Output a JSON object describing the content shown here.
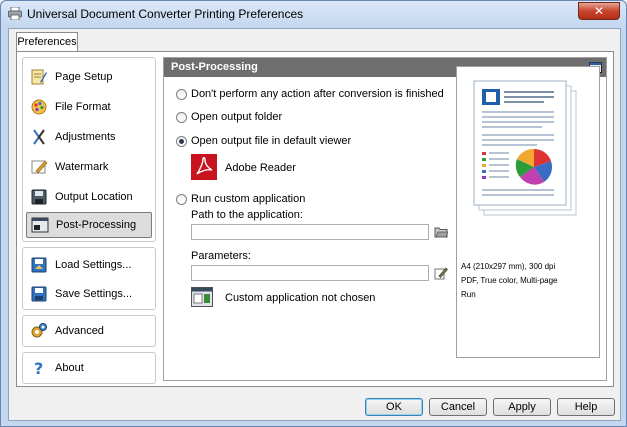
{
  "window": {
    "title": "Universal Document Converter Printing Preferences",
    "close_symbol": "✕"
  },
  "tabs": [
    {
      "label": "Preferences"
    }
  ],
  "sidebar": {
    "items": [
      {
        "label": "Page Setup",
        "icon": "page-setup-icon"
      },
      {
        "label": "File Format",
        "icon": "file-format-icon"
      },
      {
        "label": "Adjustments",
        "icon": "adjustments-icon"
      },
      {
        "label": "Watermark",
        "icon": "watermark-icon"
      },
      {
        "label": "Output Location",
        "icon": "output-location-icon"
      },
      {
        "label": "Post-Processing",
        "icon": "post-processing-icon",
        "selected": true
      }
    ],
    "settings_items": [
      {
        "label": "Load Settings...",
        "icon": "load-settings-icon"
      },
      {
        "label": "Save Settings...",
        "icon": "save-settings-icon"
      }
    ],
    "advanced": {
      "label": "Advanced",
      "icon": "advanced-icon"
    },
    "about": {
      "label": "About",
      "icon": "about-icon"
    }
  },
  "panel": {
    "title": "Post-Processing",
    "options": [
      {
        "label": "Don't perform any action after conversion is finished",
        "checked": false
      },
      {
        "label": "Open output folder",
        "checked": false
      },
      {
        "label": "Open output file in default viewer",
        "checked": true
      },
      {
        "label": "Run custom application",
        "checked": false
      }
    ],
    "viewer_name": "Adobe Reader",
    "path_label": "Path to the application:",
    "path_value": "",
    "params_label": "Parameters:",
    "params_value": "",
    "custom_app_status": "Custom application not chosen"
  },
  "preview": {
    "line1": "A4 (210x297 mm), 300 dpi",
    "line2": "PDF, True color, Multi-page",
    "line3": "Run"
  },
  "buttons": {
    "ok": "OK",
    "cancel": "Cancel",
    "apply": "Apply",
    "help": "Help"
  },
  "colors": {
    "accent_header": "#6e6e6e",
    "window_frame": "#c4d7ee",
    "close_button": "#c6452e"
  }
}
